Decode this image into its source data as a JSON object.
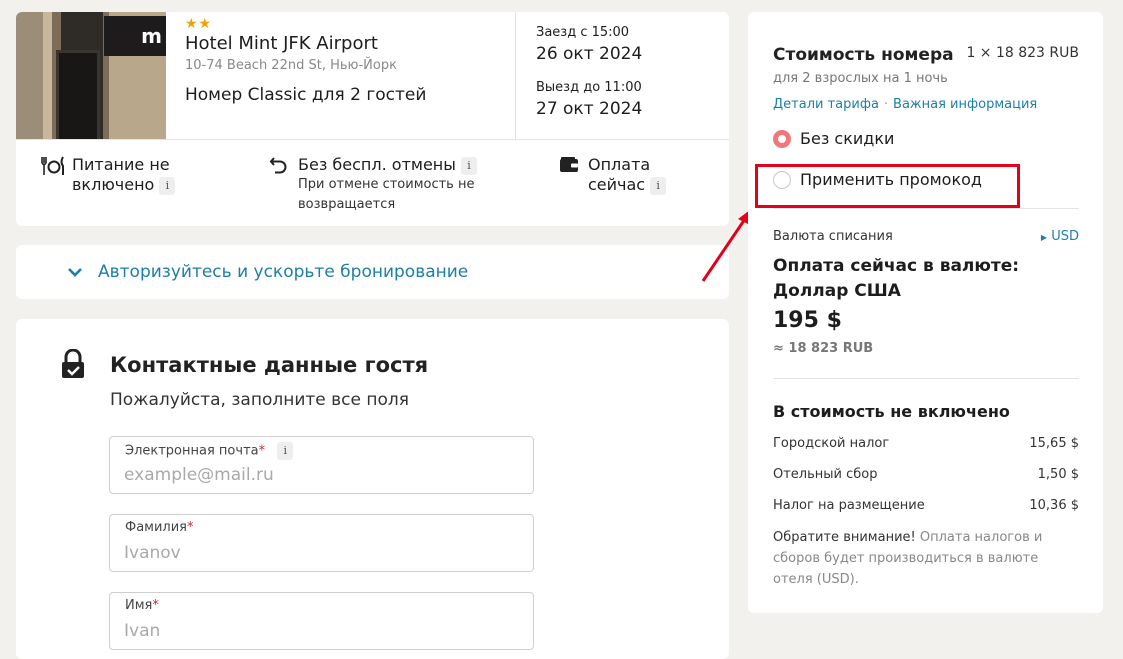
{
  "hotel": {
    "stars": "★★",
    "photo_sign": "m",
    "name": "Hotel Mint JFK Airport",
    "address": "10-74 Beach 22nd St, Нью-Йорк",
    "room": "Номер Classic для 2 гостей",
    "checkin_label": "Заезд с 15:00",
    "checkin_date": "26 окт 2024",
    "checkout_label": "Выезд до 11:00",
    "checkout_date": "27 окт 2024",
    "features": {
      "meal": "Питание не включено",
      "meal_line1": "Питание не",
      "meal_line2": "включено",
      "cancel": "Без беспл. отмены",
      "cancel_sub_line1": "При отмене стоимость не",
      "cancel_sub_line2": "возвращается",
      "payment_line1": "Оплата",
      "payment_line2": "сейчас"
    },
    "info_glyph": "i"
  },
  "login": {
    "label": "Авторизуйтесь и ускорьте бронирование",
    "icon": "chevron-down-icon"
  },
  "contact": {
    "title": "Контактные данные гостя",
    "subtitle": "Пожалуйста, заполните все поля",
    "fields": [
      {
        "label": "Электронная почта",
        "placeholder": "example@mail.ru"
      },
      {
        "label": "Фамилия",
        "placeholder": "Ivanov"
      },
      {
        "label": "Имя",
        "placeholder": "Ivan"
      }
    ],
    "required_mark": "*"
  },
  "price": {
    "title": "Стоимость номера",
    "per_night": "1 × 18 823 RUB",
    "guests": "для 2 взрослых на 1 ночь",
    "link_tariff": "Детали тарифа",
    "link_separator": "·",
    "link_important": "Важная информация",
    "options": [
      {
        "label": "Без скидки",
        "selected": true
      },
      {
        "label": "Применить промокод",
        "selected": false
      }
    ],
    "currency_label": "Валюта списания",
    "currency_link": "USD",
    "currency_title": "Оплата сейчас в валюте: Доллар США",
    "amount": "195 $",
    "amount_rub": "≈ 18 823 RUB",
    "excluded_title": "В стоимость не включено",
    "taxes": [
      {
        "name": "Городской налог",
        "value": "15,65 $"
      },
      {
        "name": "Отельный сбор",
        "value": "1,50 $"
      },
      {
        "name": "Налог на размещение",
        "value": "10,36 $"
      }
    ],
    "notice_bold": "Обратите внимание!",
    "notice_text": "Оплата налогов и сборов будет производиться в валюте отеля (USD)."
  },
  "colors": {
    "accent_blue": "#1d7ea7",
    "highlight_red": "#e3001b",
    "radio_selected": "#f3777a",
    "star": "#f0a202"
  }
}
